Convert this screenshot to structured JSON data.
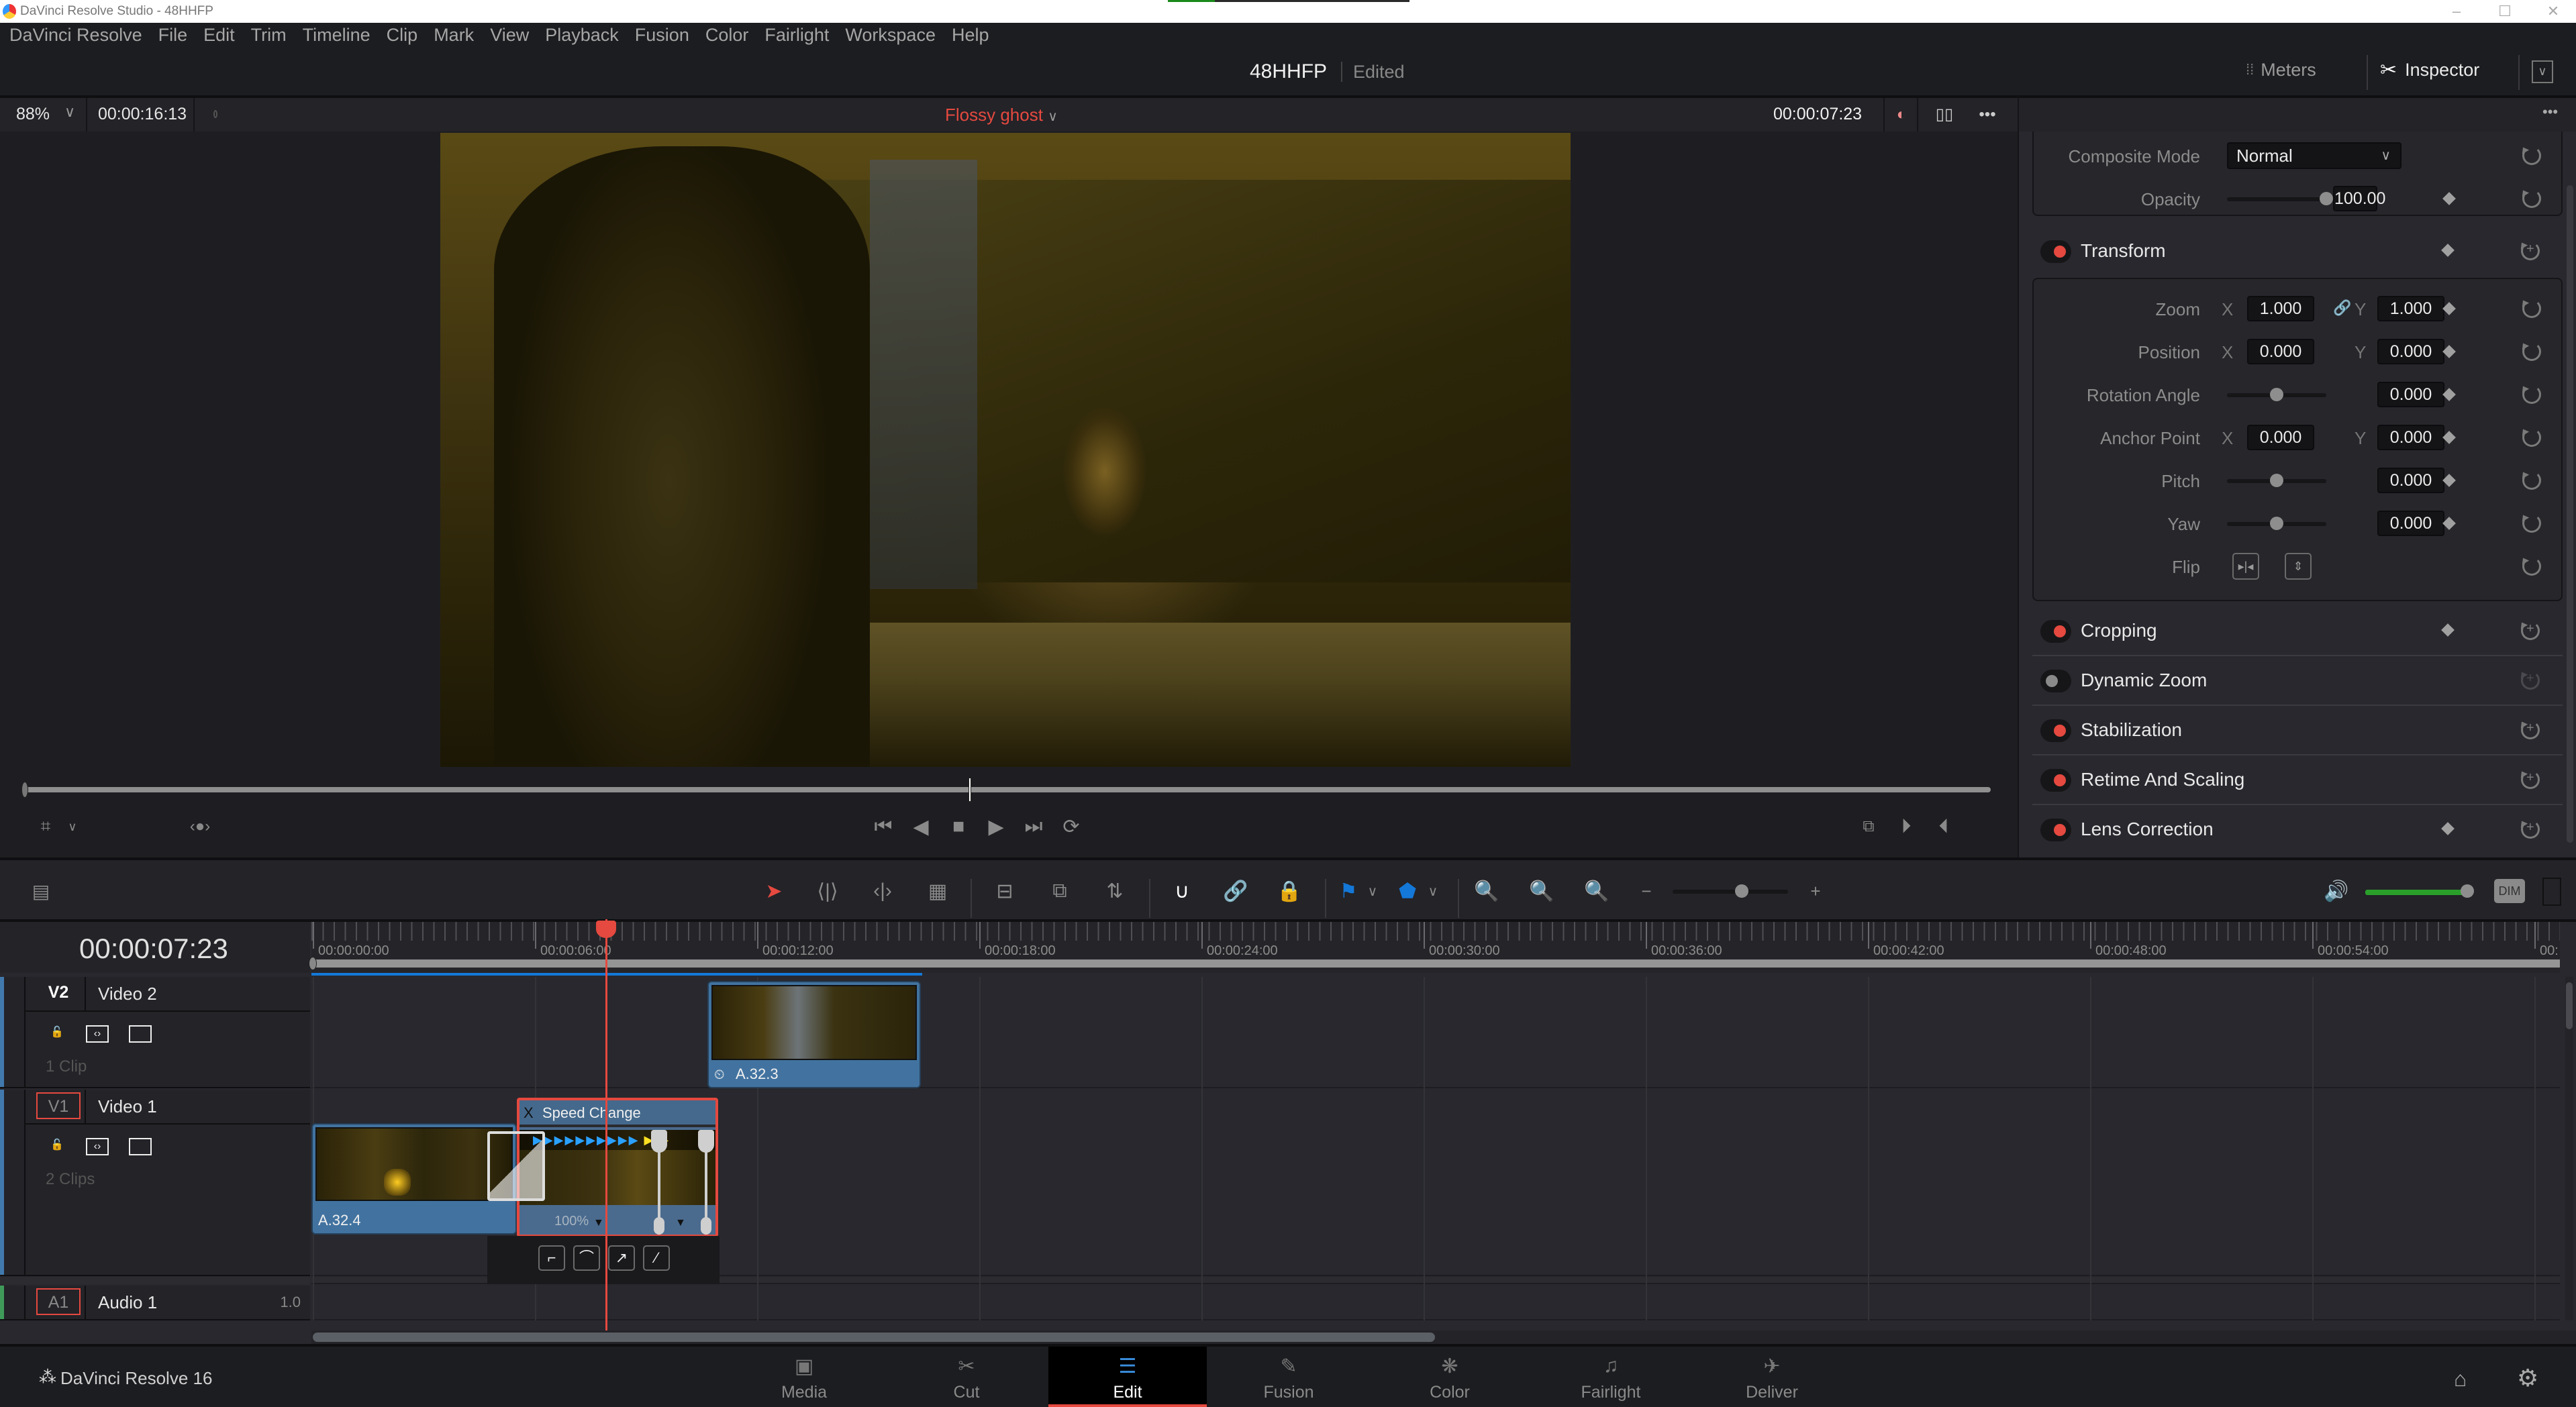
{
  "window": {
    "title": "DaVinci Resolve Studio - 48HHFP",
    "controls": {
      "minimize": "–",
      "maximize": "☐",
      "close": "✕"
    }
  },
  "menu": [
    "DaVinci Resolve",
    "File",
    "Edit",
    "Trim",
    "Timeline",
    "Clip",
    "Mark",
    "View",
    "Playback",
    "Fusion",
    "Color",
    "Fairlight",
    "Workspace",
    "Help"
  ],
  "project": {
    "name": "48HHFP",
    "status": "Edited"
  },
  "workspace_buttons": {
    "meters": "Meters",
    "inspector": "Inspector"
  },
  "viewer": {
    "zoom": "88%",
    "source_duration": "00:00:16:13",
    "clip_name": "Flossy ghost",
    "record_timecode": "00:00:07:23",
    "scrub_position_fraction": 0.48
  },
  "inspector": {
    "composite": {
      "mode_label": "Composite Mode",
      "mode_value": "Normal",
      "opacity_label": "Opacity",
      "opacity_value": "100.00",
      "opacity_fraction": 1.0
    },
    "sections": [
      {
        "title": "Transform",
        "enabled": true
      },
      {
        "title": "Cropping",
        "enabled": true
      },
      {
        "title": "Dynamic Zoom",
        "enabled": false
      },
      {
        "title": "Stabilization",
        "enabled": true
      },
      {
        "title": "Retime And Scaling",
        "enabled": true
      },
      {
        "title": "Lens Correction",
        "enabled": true
      }
    ],
    "transform": {
      "zoom": {
        "label": "Zoom",
        "x": "1.000",
        "y": "1.000"
      },
      "position": {
        "label": "Position",
        "x": "0.000",
        "y": "0.000"
      },
      "rotation": {
        "label": "Rotation Angle",
        "value": "0.000",
        "fraction": 0.5
      },
      "anchor": {
        "label": "Anchor Point",
        "x": "0.000",
        "y": "0.000"
      },
      "pitch": {
        "label": "Pitch",
        "value": "0.000",
        "fraction": 0.5
      },
      "yaw": {
        "label": "Yaw",
        "value": "0.000",
        "fraction": 0.5
      },
      "flip": {
        "label": "Flip"
      },
      "axis_x": "X",
      "axis_y": "Y"
    }
  },
  "timeline": {
    "current_timecode": "00:00:07:23",
    "ruler_labels": [
      "00:00:00:00",
      "00:00:06:00",
      "00:00:12:00",
      "00:00:18:00",
      "00:00:24:00",
      "00:00:30:00",
      "00:00:36:00",
      "00:00:42:00",
      "00:00:48:00",
      "00:00:54:00",
      "00:"
    ],
    "tracks": [
      {
        "id": "V2",
        "name": "Video 2",
        "count": "1 Clip"
      },
      {
        "id": "V1",
        "name": "Video 1",
        "count": "2 Clips"
      },
      {
        "id": "A1",
        "name": "Audio 1",
        "volume": "1.0"
      }
    ],
    "clips": {
      "v2_clip": "A.32.3",
      "v1_clip": "A.32.4",
      "speed_clip_header": "Speed Change",
      "speed_clip_close": "X",
      "speed_percent": "100%"
    },
    "audio_level_fraction": 0.95,
    "zoom_slider_fraction": 0.6,
    "dim_label": "DIM"
  },
  "pages": [
    {
      "label": "Media",
      "icon": "media-icon"
    },
    {
      "label": "Cut",
      "icon": "cut-icon"
    },
    {
      "label": "Edit",
      "icon": "edit-icon",
      "active": true
    },
    {
      "label": "Fusion",
      "icon": "fusion-icon"
    },
    {
      "label": "Color",
      "icon": "color-icon"
    },
    {
      "label": "Fairlight",
      "icon": "fairlight-icon"
    },
    {
      "label": "Deliver",
      "icon": "deliver-icon"
    }
  ],
  "brand": "DaVinci Resolve 16",
  "colors": {
    "accent_red": "#e5493f",
    "clip_blue": "#4273a0",
    "marker_blue": "#1478d8",
    "audio_green": "#2aa02a"
  }
}
